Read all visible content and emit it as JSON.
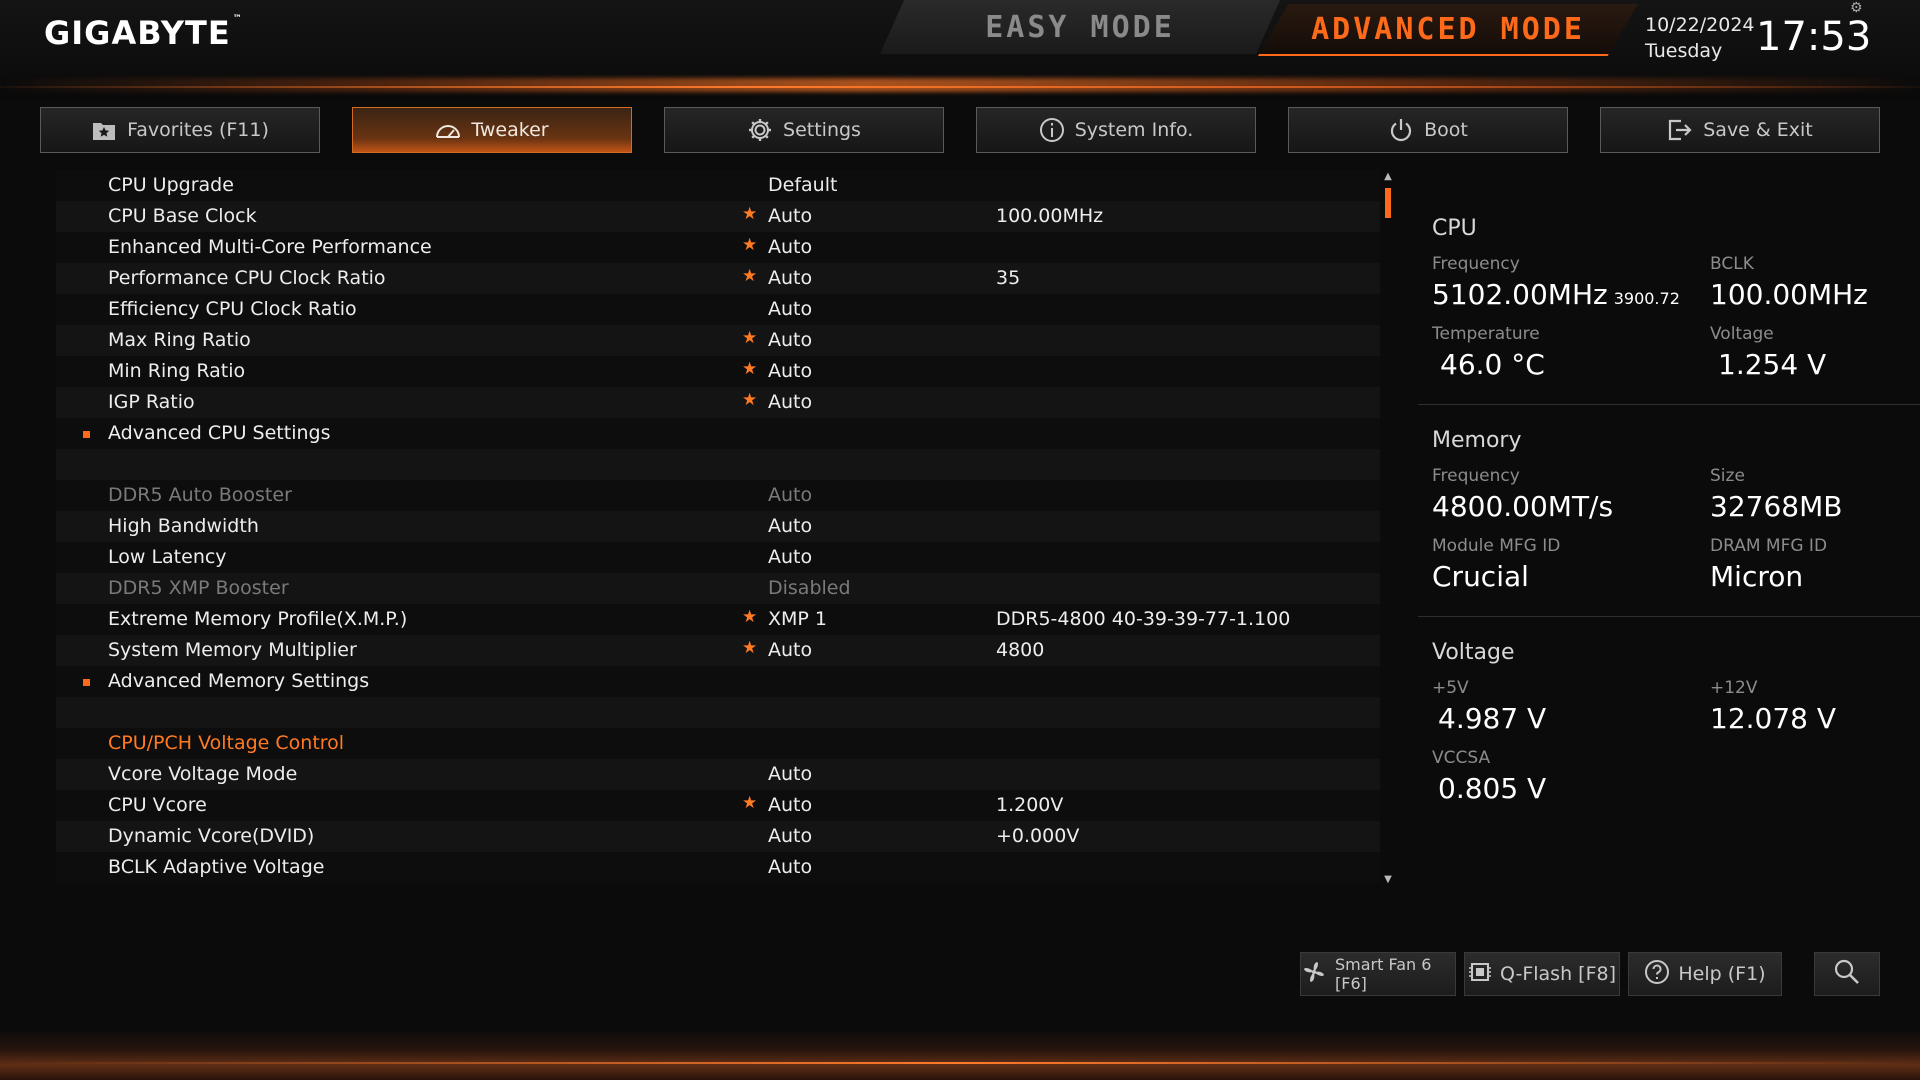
{
  "header": {
    "brand": "GIGABYTE",
    "trademark": "™",
    "easy_mode": "EASY MODE",
    "advanced_mode": "ADVANCED MODE",
    "date": "10/22/2024",
    "day": "Tuesday",
    "time": "17:53"
  },
  "tabs": [
    {
      "label": "Favorites (F11)",
      "icon": "star-folder-icon"
    },
    {
      "label": "Tweaker",
      "icon": "speedometer-icon",
      "active": true
    },
    {
      "label": "Settings",
      "icon": "gear-icon"
    },
    {
      "label": "System Info.",
      "icon": "info-icon"
    },
    {
      "label": "Boot",
      "icon": "power-icon"
    },
    {
      "label": "Save & Exit",
      "icon": "exit-icon"
    }
  ],
  "settings": [
    {
      "name": "CPU Upgrade",
      "value": "Default",
      "extra": ""
    },
    {
      "name": "CPU Base Clock",
      "value": "Auto",
      "extra": "100.00MHz",
      "star": "★"
    },
    {
      "name": "Enhanced Multi-Core Performance",
      "value": "Auto",
      "extra": "",
      "star": "★"
    },
    {
      "name": "Performance CPU Clock Ratio",
      "value": "Auto",
      "extra": "35",
      "star": "★"
    },
    {
      "name": "Efficiency CPU Clock Ratio",
      "value": "Auto",
      "extra": ""
    },
    {
      "name": "Max Ring Ratio",
      "value": "Auto",
      "extra": "",
      "star": "★"
    },
    {
      "name": "Min Ring Ratio",
      "value": "Auto",
      "extra": "",
      "star": "★"
    },
    {
      "name": "IGP Ratio",
      "value": "Auto",
      "extra": "",
      "star": "★"
    },
    {
      "name": "Advanced CPU Settings",
      "value": "",
      "extra": "",
      "submenu": true
    },
    {
      "name": "",
      "value": "",
      "extra": ""
    },
    {
      "name": "DDR5 Auto Booster",
      "value": "Auto",
      "extra": "",
      "dim": true
    },
    {
      "name": "High Bandwidth",
      "value": "Auto",
      "extra": ""
    },
    {
      "name": "Low Latency",
      "value": "Auto",
      "extra": ""
    },
    {
      "name": "DDR5 XMP Booster",
      "value": "Disabled",
      "extra": "",
      "dim": true
    },
    {
      "name": "Extreme Memory Profile(X.M.P.)",
      "value": "XMP 1",
      "extra": "DDR5-4800 40-39-39-77-1.100",
      "star": "★"
    },
    {
      "name": "System Memory Multiplier",
      "value": "Auto",
      "extra": "4800",
      "star": "★"
    },
    {
      "name": "Advanced Memory Settings",
      "value": "",
      "extra": "",
      "submenu": true
    },
    {
      "name": "",
      "value": "",
      "extra": ""
    },
    {
      "name": "CPU/PCH Voltage Control",
      "value": "",
      "extra": "",
      "section": true
    },
    {
      "name": "Vcore Voltage Mode",
      "value": "Auto",
      "extra": ""
    },
    {
      "name": "CPU Vcore",
      "value": "Auto",
      "extra": "1.200V",
      "star": "★"
    },
    {
      "name": "Dynamic Vcore(DVID)",
      "value": "Auto",
      "extra": "+0.000V"
    },
    {
      "name": "BCLK Adaptive Voltage",
      "value": "Auto",
      "extra": ""
    }
  ],
  "panel": {
    "cpu": {
      "title": "CPU",
      "freq_label": "Frequency",
      "freq": "5102.00MHz",
      "freq_sub": "3900.72",
      "bclk_label": "BCLK",
      "bclk": "100.00MHz",
      "temp_label": "Temperature",
      "temp": "46.0 °C",
      "volt_label": "Voltage",
      "volt": "1.254 V"
    },
    "memory": {
      "title": "Memory",
      "freq_label": "Frequency",
      "freq": "4800.00MT/s",
      "size_label": "Size",
      "size": "32768MB",
      "mfg_label": "Module MFG ID",
      "mfg": "Crucial",
      "dram_label": "DRAM MFG ID",
      "dram": "Micron"
    },
    "voltage": {
      "title": "Voltage",
      "v5_label": "+5V",
      "v5": "4.987 V",
      "v12_label": "+12V",
      "v12": "12.078 V",
      "vccsa_label": "VCCSA",
      "vccsa": "0.805 V"
    }
  },
  "bottom": {
    "smart_fan": "Smart Fan 6 [F6]",
    "qflash": "Q-Flash [F8]",
    "help": "Help (F1)"
  },
  "colors": {
    "accent": "#ff6a1a",
    "background": "#0b0b0c"
  }
}
